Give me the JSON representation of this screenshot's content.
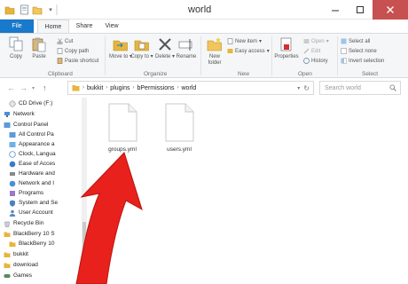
{
  "window": {
    "title": "world"
  },
  "tabs": {
    "file": "File",
    "home": "Home",
    "share": "Share",
    "view": "View"
  },
  "ribbon": {
    "copy": "Copy",
    "paste": "Paste",
    "cut": "Cut",
    "copy_path": "Copy path",
    "paste_shortcut": "Paste shortcut",
    "move_to": "Move to",
    "copy_to": "Copy to",
    "delete": "Delete",
    "rename": "Rename",
    "new_folder": "New folder",
    "new_item": "New item",
    "easy_access": "Easy access",
    "properties": "Properties",
    "open": "Open",
    "edit": "Edit",
    "history": "History",
    "select_all": "Select all",
    "select_none": "Select none",
    "invert_selection": "Invert selection",
    "groups": {
      "clipboard": "Clipboard",
      "organize": "Organize",
      "new": "New",
      "open": "Open",
      "select": "Select"
    }
  },
  "address": {
    "crumbs": [
      "bukkit",
      "plugins",
      "bPermissions",
      "world"
    ],
    "search_placeholder": "Search world"
  },
  "nav": {
    "items": [
      "CD Drive (F:)",
      "Network",
      "Control Panel",
      "All Control Pa",
      "Appearance a",
      "Clock, Langua",
      "Ease of Acces",
      "Hardware and",
      "Network and I",
      "Programs",
      "System and Se",
      "User Account",
      "Recycle Bin",
      "BlackBerry 10 S",
      "BlackBerry 10",
      "bukkit",
      "download",
      "Games"
    ]
  },
  "files": [
    {
      "name": "groups.yml",
      "icon": "yml-file-icon"
    },
    {
      "name": "users.yml",
      "icon": "yml-file-icon"
    }
  ],
  "colors": {
    "accent": "#1979ca",
    "arrow": "#e8211d",
    "folder": "#e8b53b"
  }
}
